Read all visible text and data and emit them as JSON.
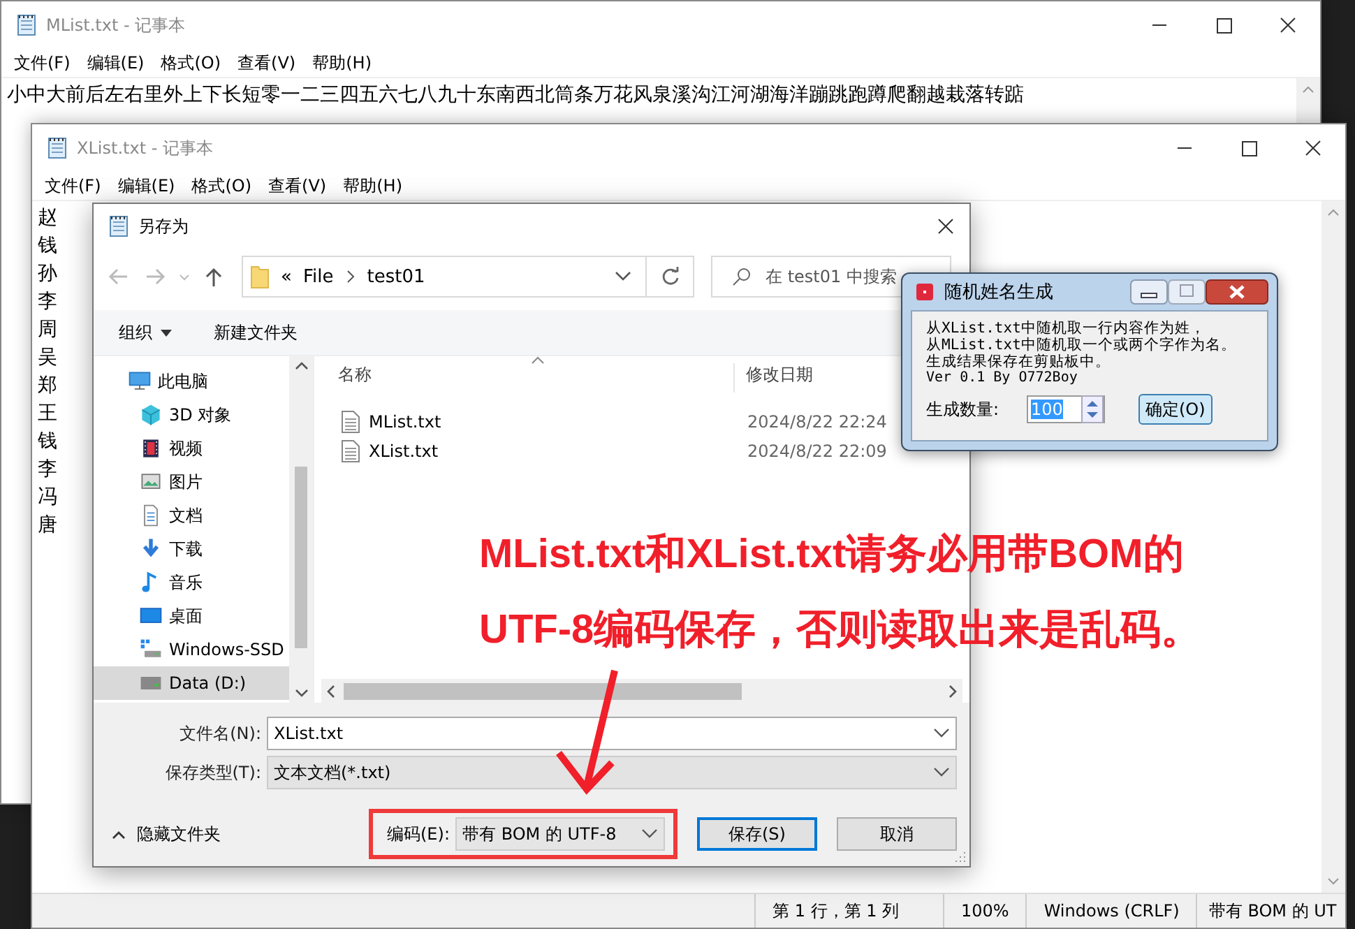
{
  "notepad_windows": [
    {
      "title": "MList.txt - 记事本",
      "menu": [
        "文件(F)",
        "编辑(E)",
        "格式(O)",
        "查看(V)",
        "帮助(H)"
      ],
      "lines": [
        "小中大前后左右里外上下长短零一二三四五六七八九十东南西北筒条万花风泉溪沟江河湖海洋蹦跳跑蹲爬翻越栽落转踮"
      ]
    },
    {
      "title": "XList.txt - 记事本",
      "menu": [
        "文件(F)",
        "编辑(E)",
        "格式(O)",
        "查看(V)",
        "帮助(H)"
      ],
      "lines": [
        "赵",
        "钱",
        "孙",
        "李",
        "周",
        "吴",
        "郑",
        "王",
        "钱",
        "李",
        "冯",
        "唐"
      ],
      "status_bar": [
        "第 1 行，第 1 列",
        "100%",
        "Windows (CRLF)",
        "带有 BOM 的 UT"
      ]
    }
  ],
  "save_dialog": {
    "title": "另存为",
    "breadcrumb_prefix": "«",
    "breadcrumb": [
      "File",
      "test01"
    ],
    "search": {
      "placeholder": "在 test01 中搜索"
    },
    "toolbar": [
      "组织",
      "新建文件夹"
    ],
    "sidebar": {
      "items": [
        {
          "label": "此电脑",
          "selected": false,
          "children": [
            {
              "label": "3D 对象",
              "selected": false
            },
            {
              "label": "视频",
              "selected": false
            },
            {
              "label": "图片",
              "selected": false
            },
            {
              "label": "文档",
              "selected": false
            },
            {
              "label": "下载",
              "selected": false
            },
            {
              "label": "音乐",
              "selected": false
            },
            {
              "label": "桌面",
              "selected": false
            },
            {
              "label": "Windows-SSD",
              "selected": false
            },
            {
              "label": "Data (D:)",
              "selected": true
            }
          ]
        }
      ]
    },
    "table": {
      "columns": [
        "名称",
        "修改日期"
      ],
      "rows": [
        {
          "cells": [
            "MList.txt",
            "2024/8/22 22:24"
          ],
          "selected": false
        },
        {
          "cells": [
            "XList.txt",
            "2024/8/22 22:09"
          ],
          "selected": false
        }
      ]
    },
    "fields": [
      {
        "label": "文件名(N):",
        "value": "XList.txt",
        "disabled": false
      },
      {
        "label": "保存类型(T):",
        "value": "文本文档(*.txt)",
        "disabled": true
      }
    ],
    "hide_folders": "隐藏文件夹",
    "encoding": {
      "label": "编码(E):",
      "value": "带有 BOM 的 UTF-8"
    },
    "buttons": [
      {
        "label": "保存(S)",
        "default": true
      },
      {
        "label": "取消",
        "default": false
      }
    ]
  },
  "app_dialog": {
    "title": "随机姓名生成",
    "lines": [
      "从XList.txt中随机取一行内容作为姓，",
      "从MList.txt中随机取一个或两个字作为名。",
      "生成结果保存在剪贴板中。",
      "Ver 0.1 By O772Boy"
    ],
    "count": {
      "label": "生成数量:",
      "value": "100",
      "value_selected": true
    },
    "button": "确定(O)"
  },
  "annotation": {
    "lines": [
      "MList.txt和XList.txt请务必用带BOM的",
      "UTF-8编码保存，否则读取出来是乱码。"
    ]
  }
}
